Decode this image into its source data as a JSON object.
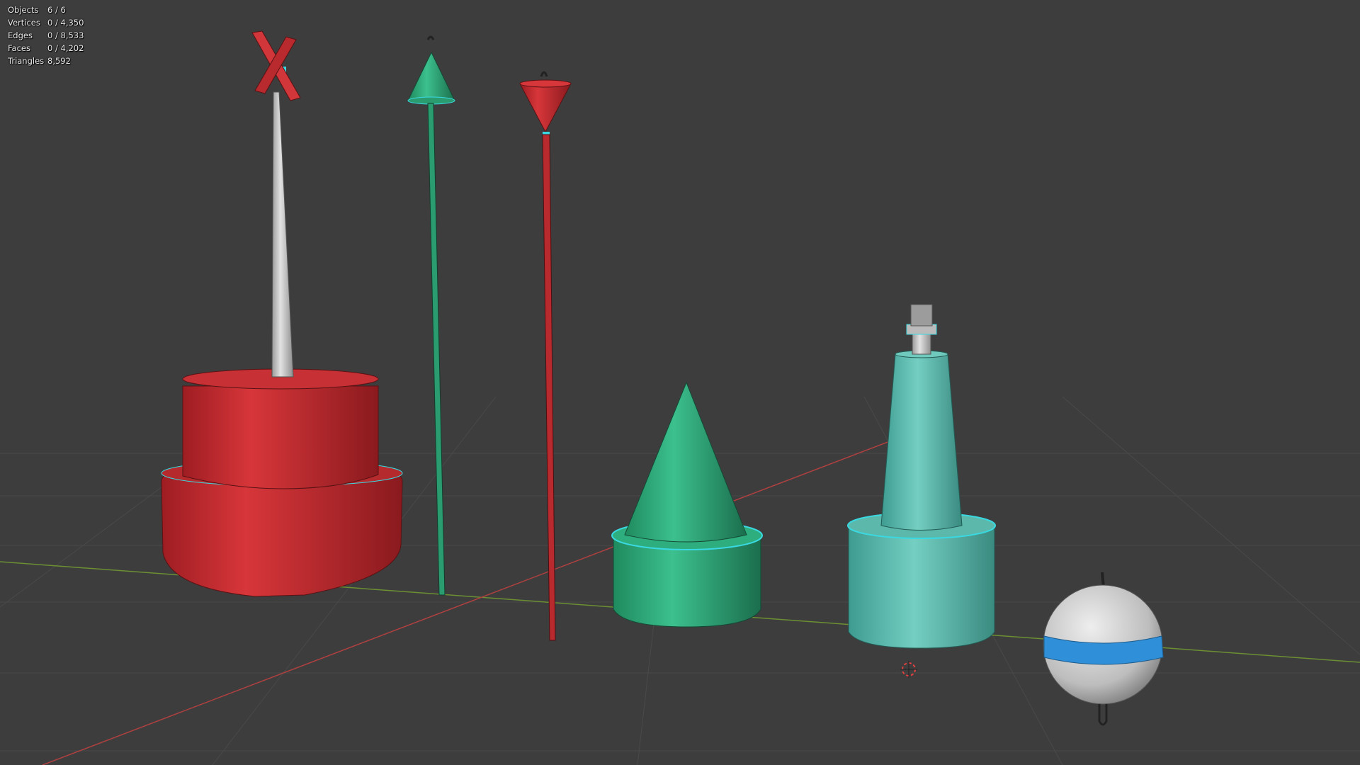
{
  "stats_overlay": [
    {
      "label": "Objects",
      "value": "6 / 6"
    },
    {
      "label": "Vertices",
      "value": "0 / 4,350"
    },
    {
      "label": "Edges",
      "value": "0 / 8,533"
    },
    {
      "label": "Faces",
      "value": "0 / 4,202"
    },
    {
      "label": "Triangles",
      "value": "8,592"
    }
  ],
  "colors": {
    "background": "#3d3d3d",
    "grid_line": "#4a4a4a",
    "x_axis": "#b04040",
    "y_axis": "#6c8f33",
    "red_paint": "#cc2d30",
    "green_paint": "#2fb07c",
    "cyan_paint": "#5dbfb0",
    "white_paint": "#c8c8c8",
    "blue_band": "#2f8fd8",
    "edge_highlight": "#3ad8e0",
    "cursor": "#e04040"
  },
  "objects": [
    {
      "name": "red-cylinder-buoy-icon"
    },
    {
      "name": "green-cone-pole-icon"
    },
    {
      "name": "red-cone-pole-icon"
    },
    {
      "name": "green-cone-buoy-icon"
    },
    {
      "name": "cyan-tower-buoy-icon"
    },
    {
      "name": "white-sphere-buoy-icon"
    }
  ]
}
